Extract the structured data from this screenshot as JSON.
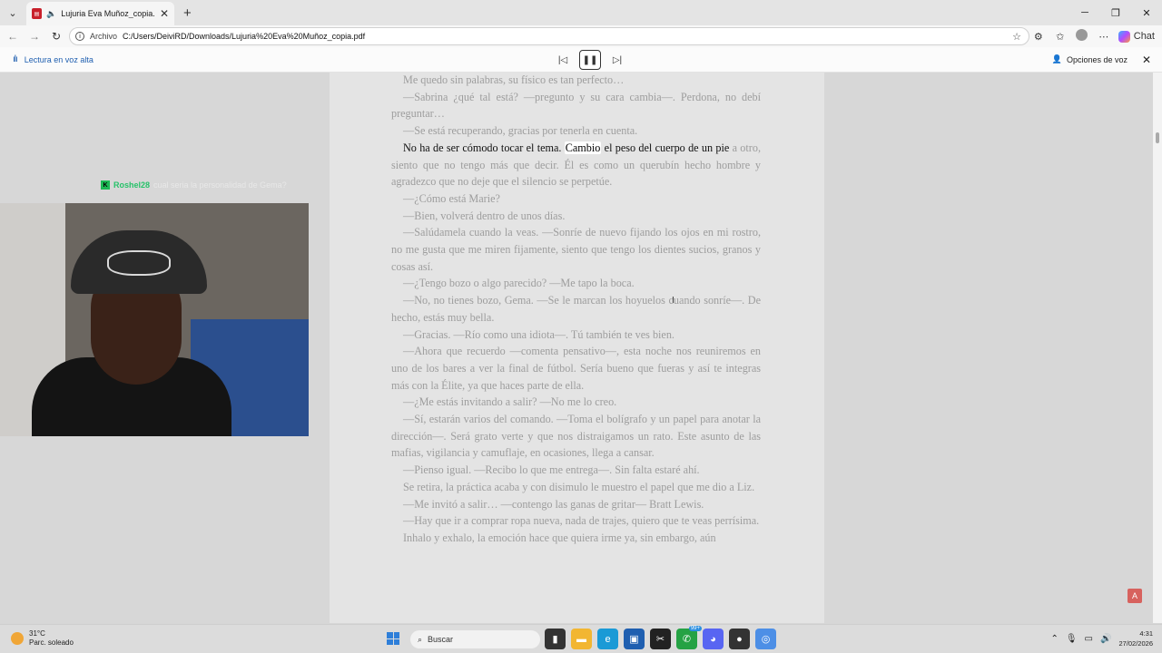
{
  "browser": {
    "tab_title": "Lujuria Eva Muñoz_copia.pdf",
    "url_scheme_label": "Archivo",
    "url": "C:/Users/DeiviRD/Downloads/Lujuria%20Eva%20Muñoz_copia.pdf",
    "chat_label": "Chat"
  },
  "read_aloud": {
    "label": "Lectura en voz alta",
    "voice_options_label": "Opciones de voz"
  },
  "document": {
    "paragraphs": [
      {
        "text": "Me quedo sin palabras, su físico es tan perfecto…"
      },
      {
        "text": "—Sabrina ¿qué tal está? —pregunto y su cara cambia—. Perdona, no debí preguntar…"
      },
      {
        "text": "—Se está recuperando, gracias por tenerla en cuenta."
      },
      {
        "before": "No ha de ser cómodo tocar el tema. ",
        "highlight": "Cambio",
        "after": " el peso del cuerpo de un pie",
        "rest": " a otro, siento que no tengo más que decir. Él es como un querubín hecho hombre y agradezco que no deje que el silencio se perpetúe."
      },
      {
        "text": "—¿Cómo está Marie?"
      },
      {
        "text": "—Bien, volverá dentro de unos días."
      },
      {
        "text": "—Salúdamela cuando la veas. —Sonríe de nuevo fijando los ojos en mi rostro, no me gusta que me miren fijamente, siento que tengo los dientes sucios, granos y cosas así."
      },
      {
        "text": "—¿Tengo bozo o algo parecido? —Me tapo la boca."
      },
      {
        "text": "—No, no tienes bozo, Gema. —Se le marcan los hoyuelos cuando sonríe—. De hecho, estás muy bella."
      },
      {
        "text": "—Gracias. —Río como una idiota—. Tú también te ves bien."
      },
      {
        "text": "—Ahora que recuerdo —comenta pensativo—, esta noche nos reuniremos en uno de los bares a ver la final de fútbol. Sería bueno que fueras y así te integras más con la Élite, ya que haces parte de ella."
      },
      {
        "text": "—¿Me estás invitando a salir? —No me lo creo."
      },
      {
        "text": "—Sí, estarán varios del comando. —Toma el bolígrafo y un papel para anotar la dirección—. Será grato verte y que nos distraigamos un rato. Este asunto de las mafias, vigilancia y camuflaje, en ocasiones, llega a cansar."
      },
      {
        "text": "—Pienso igual. —Recibo lo que me entrega—. Sin falta estaré ahí."
      },
      {
        "text": "Se retira, la práctica acaba y con disimulo le muestro el papel que me dio a Liz."
      },
      {
        "text": "—Me invitó a salir… —contengo las ganas de gritar— Bratt Lewis."
      },
      {
        "text": "—Hay que ir a comprar ropa nueva, nada de trajes, quiero que te veas perrísima."
      },
      {
        "text": "Inhalo y exhalo, la emoción hace que quiera irme ya, sin embargo, aún"
      }
    ]
  },
  "stream_overlay": {
    "badge": "K",
    "chat_user": "Roshel28",
    "chat_text": "cual seria la personalidad de Gema?"
  },
  "taskbar": {
    "temperature": "31°C",
    "weather_desc": "Parc. soleado",
    "search_placeholder": "Buscar",
    "whatsapp_badge": "99+",
    "time": "4:31",
    "date": "27/02/2026"
  }
}
